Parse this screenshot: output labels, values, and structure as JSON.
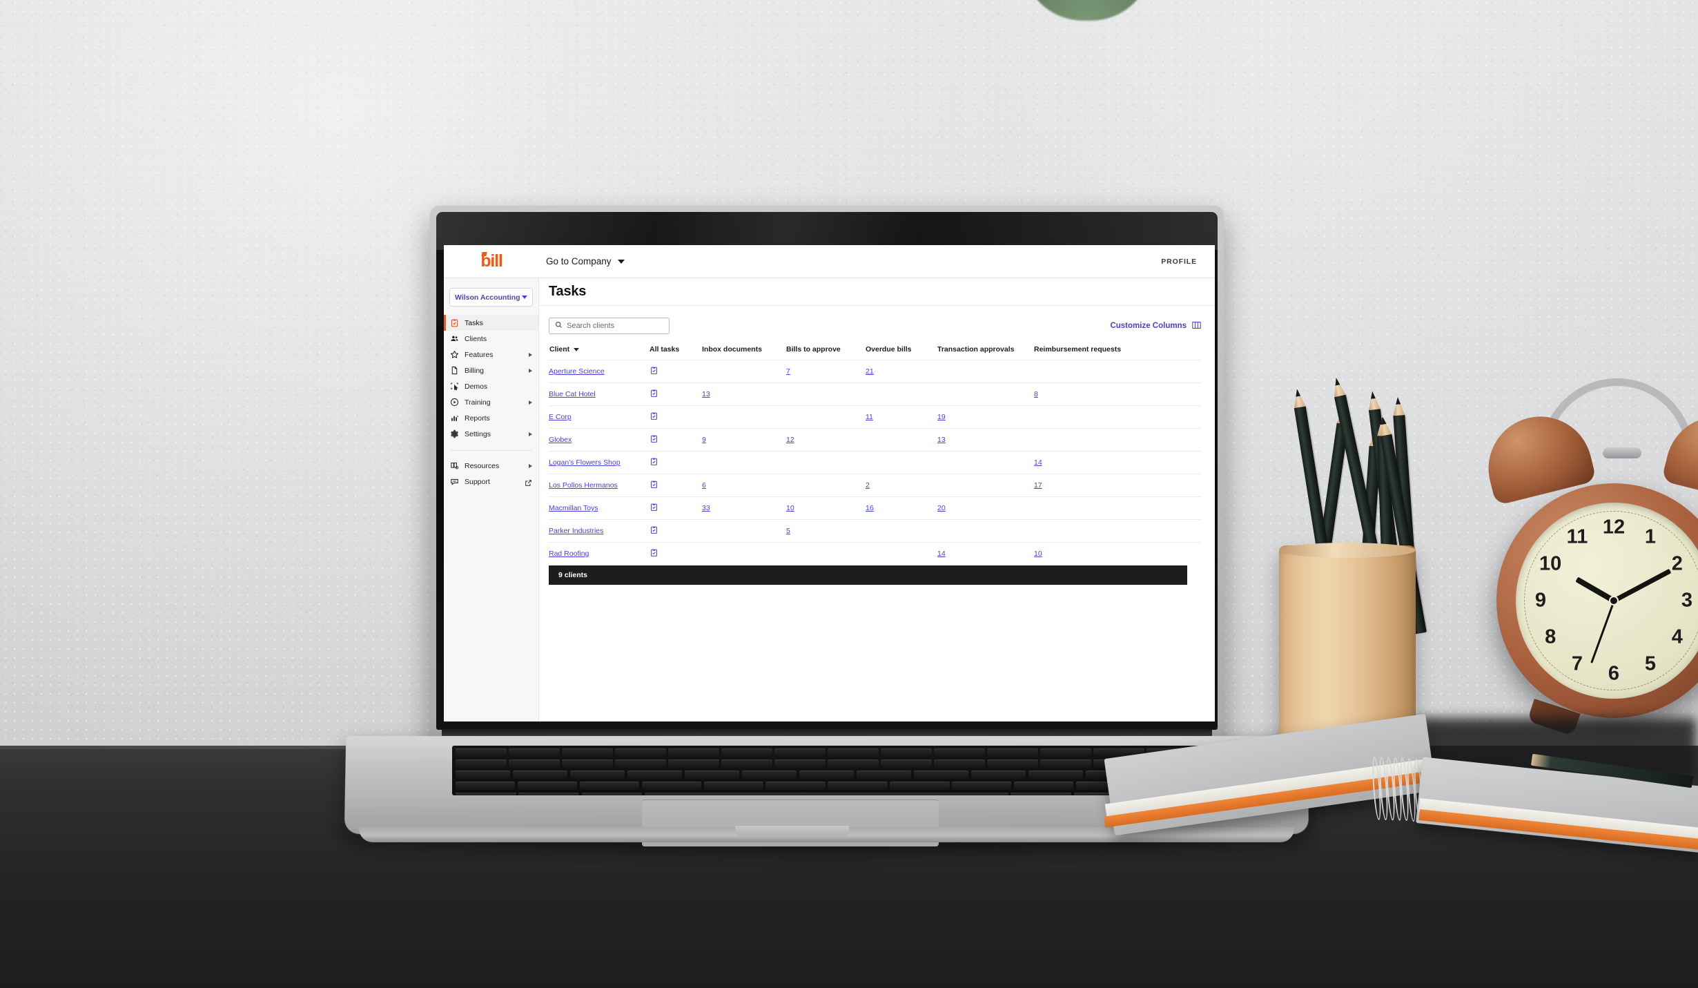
{
  "app": {
    "logo_text": "bill",
    "company_switcher": "Go to Company",
    "profile_label": "PROFILE"
  },
  "sidebar": {
    "org_name": "Wilson Accounting",
    "items": [
      {
        "label": "Tasks",
        "icon": "clipboard-check-icon",
        "active": true,
        "arrow": false,
        "external": false
      },
      {
        "label": "Clients",
        "icon": "people-icon",
        "active": false,
        "arrow": false,
        "external": false
      },
      {
        "label": "Features",
        "icon": "star-icon",
        "active": false,
        "arrow": true,
        "external": false
      },
      {
        "label": "Billing",
        "icon": "document-icon",
        "active": false,
        "arrow": true,
        "external": false
      },
      {
        "label": "Demos",
        "icon": "screen-cursor-icon",
        "active": false,
        "arrow": false,
        "external": false
      },
      {
        "label": "Training",
        "icon": "play-circle-icon",
        "active": false,
        "arrow": true,
        "external": false
      },
      {
        "label": "Reports",
        "icon": "bar-chart-icon",
        "active": false,
        "arrow": false,
        "external": false
      },
      {
        "label": "Settings",
        "icon": "gear-icon",
        "active": false,
        "arrow": true,
        "external": false
      }
    ],
    "secondary_items": [
      {
        "label": "Resources",
        "icon": "books-icon",
        "arrow": true,
        "external": false
      },
      {
        "label": "Support",
        "icon": "chat-bubble-icon",
        "arrow": false,
        "external": true
      }
    ]
  },
  "page": {
    "title": "Tasks"
  },
  "toolbar": {
    "search_placeholder": "Search clients",
    "search_value": "",
    "customize_columns_label": "Customize Columns"
  },
  "table": {
    "columns": [
      {
        "key": "client",
        "label": "Client",
        "sortable": true
      },
      {
        "key": "all_tasks",
        "label": "All tasks",
        "sortable": false
      },
      {
        "key": "inbox_documents",
        "label": "Inbox documents",
        "sortable": false
      },
      {
        "key": "bills_to_approve",
        "label": "Bills to approve",
        "sortable": false
      },
      {
        "key": "overdue_bills",
        "label": "Overdue bills",
        "sortable": false
      },
      {
        "key": "transaction_approvals",
        "label": "Transaction approvals",
        "sortable": false
      },
      {
        "key": "reimbursement_requests",
        "label": "Reimbursement requests",
        "sortable": false
      }
    ],
    "rows": [
      {
        "client": "Aperture Science",
        "all_tasks": "task-icon",
        "inbox_documents": "",
        "bills_to_approve": "7",
        "overdue_bills": "21",
        "transaction_approvals": "",
        "reimbursement_requests": ""
      },
      {
        "client": "Blue Cat Hotel",
        "all_tasks": "task-icon",
        "inbox_documents": "13",
        "bills_to_approve": "",
        "overdue_bills": "",
        "transaction_approvals": "",
        "reimbursement_requests": "8"
      },
      {
        "client": "E Corp",
        "all_tasks": "task-icon",
        "inbox_documents": "",
        "bills_to_approve": "",
        "overdue_bills": "11",
        "transaction_approvals": "19",
        "reimbursement_requests": ""
      },
      {
        "client": "Globex",
        "all_tasks": "task-icon",
        "inbox_documents": "9",
        "bills_to_approve": "12",
        "overdue_bills": "",
        "transaction_approvals": "13",
        "reimbursement_requests": ""
      },
      {
        "client": "Logan's Flowers Shop",
        "all_tasks": "task-icon",
        "inbox_documents": "",
        "bills_to_approve": "",
        "overdue_bills": "",
        "transaction_approvals": "",
        "reimbursement_requests": "14"
      },
      {
        "client": "Los Pollos Hermanos",
        "all_tasks": "task-icon",
        "inbox_documents": "6",
        "bills_to_approve": "",
        "overdue_bills": "2",
        "transaction_approvals": "",
        "reimbursement_requests": "17"
      },
      {
        "client": "Macmillan Toys",
        "all_tasks": "task-icon",
        "inbox_documents": "33",
        "bills_to_approve": "10",
        "overdue_bills": "16",
        "transaction_approvals": "20",
        "reimbursement_requests": ""
      },
      {
        "client": "Parker Industries",
        "all_tasks": "task-icon",
        "inbox_documents": "",
        "bills_to_approve": "5",
        "overdue_bills": "",
        "transaction_approvals": "",
        "reimbursement_requests": ""
      },
      {
        "client": "Rad Roofing",
        "all_tasks": "task-icon",
        "inbox_documents": "",
        "bills_to_approve": "",
        "overdue_bills": "",
        "transaction_approvals": "14",
        "reimbursement_requests": "10"
      }
    ],
    "footer_count": "9 clients"
  },
  "colors": {
    "brand_orange": "#ec5a13",
    "link_purple": "#4a3ed8",
    "footer_dark": "#1d1d20",
    "sidebar_bg": "#f7f7f8"
  }
}
